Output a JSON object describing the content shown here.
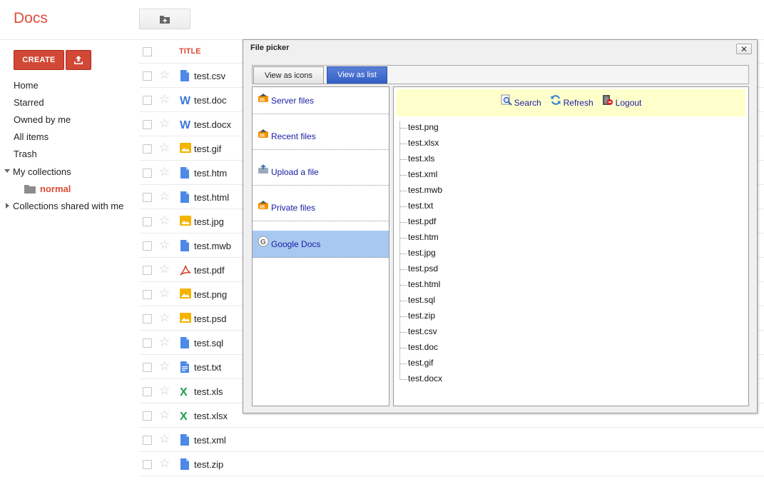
{
  "app": {
    "logo": "Docs",
    "create_label": "CREATE"
  },
  "sidebar": {
    "items": [
      {
        "label": "Home"
      },
      {
        "label": "Starred"
      },
      {
        "label": "Owned by me"
      },
      {
        "label": "All items"
      },
      {
        "label": "Trash"
      },
      {
        "label": "My collections"
      },
      {
        "label": "normal"
      },
      {
        "label": "Collections shared with me"
      }
    ]
  },
  "list": {
    "title_header": "TITLE",
    "files": [
      {
        "name": "test.csv",
        "icon": "doc-icon"
      },
      {
        "name": "test.doc",
        "icon": "word-icon"
      },
      {
        "name": "test.docx",
        "icon": "word-icon"
      },
      {
        "name": "test.gif",
        "icon": "image-icon"
      },
      {
        "name": "test.htm",
        "icon": "doc-icon"
      },
      {
        "name": "test.html",
        "icon": "doc-icon"
      },
      {
        "name": "test.jpg",
        "icon": "image-icon"
      },
      {
        "name": "test.mwb",
        "icon": "doc-icon"
      },
      {
        "name": "test.pdf",
        "icon": "pdf-icon"
      },
      {
        "name": "test.png",
        "icon": "image-icon"
      },
      {
        "name": "test.psd",
        "icon": "image-icon"
      },
      {
        "name": "test.sql",
        "icon": "doc-icon"
      },
      {
        "name": "test.txt",
        "icon": "text-doc-icon"
      },
      {
        "name": "test.xls",
        "icon": "excel-icon"
      },
      {
        "name": "test.xlsx",
        "icon": "excel-icon"
      },
      {
        "name": "test.xml",
        "icon": "doc-icon"
      },
      {
        "name": "test.zip",
        "icon": "doc-icon"
      }
    ]
  },
  "picker": {
    "title": "File picker",
    "close": "✕",
    "tabs": [
      {
        "label": "View as icons"
      },
      {
        "label": "View as list"
      }
    ],
    "sources": [
      {
        "label": "Server files"
      },
      {
        "label": "Recent files"
      },
      {
        "label": "Upload a file"
      },
      {
        "label": "Private files"
      },
      {
        "label": "Google Docs"
      }
    ],
    "toolbar": {
      "search": "Search",
      "refresh": "Refresh",
      "logout": "Logout"
    },
    "files": [
      "test.png",
      "test.xlsx",
      "test.xls",
      "test.xml",
      "test.mwb",
      "test.txt",
      "test.pdf",
      "test.htm",
      "test.jpg",
      "test.psd",
      "test.html",
      "test.sql",
      "test.zip",
      "test.csv",
      "test.doc",
      "test.gif",
      "test.docx"
    ]
  },
  "colors": {
    "brand_red": "#dd4b39",
    "create_red": "#d14836",
    "selected_source": "#a8c8f0",
    "toolbar_bg": "#ffffcc",
    "link_blue": "#1a1aa6"
  }
}
